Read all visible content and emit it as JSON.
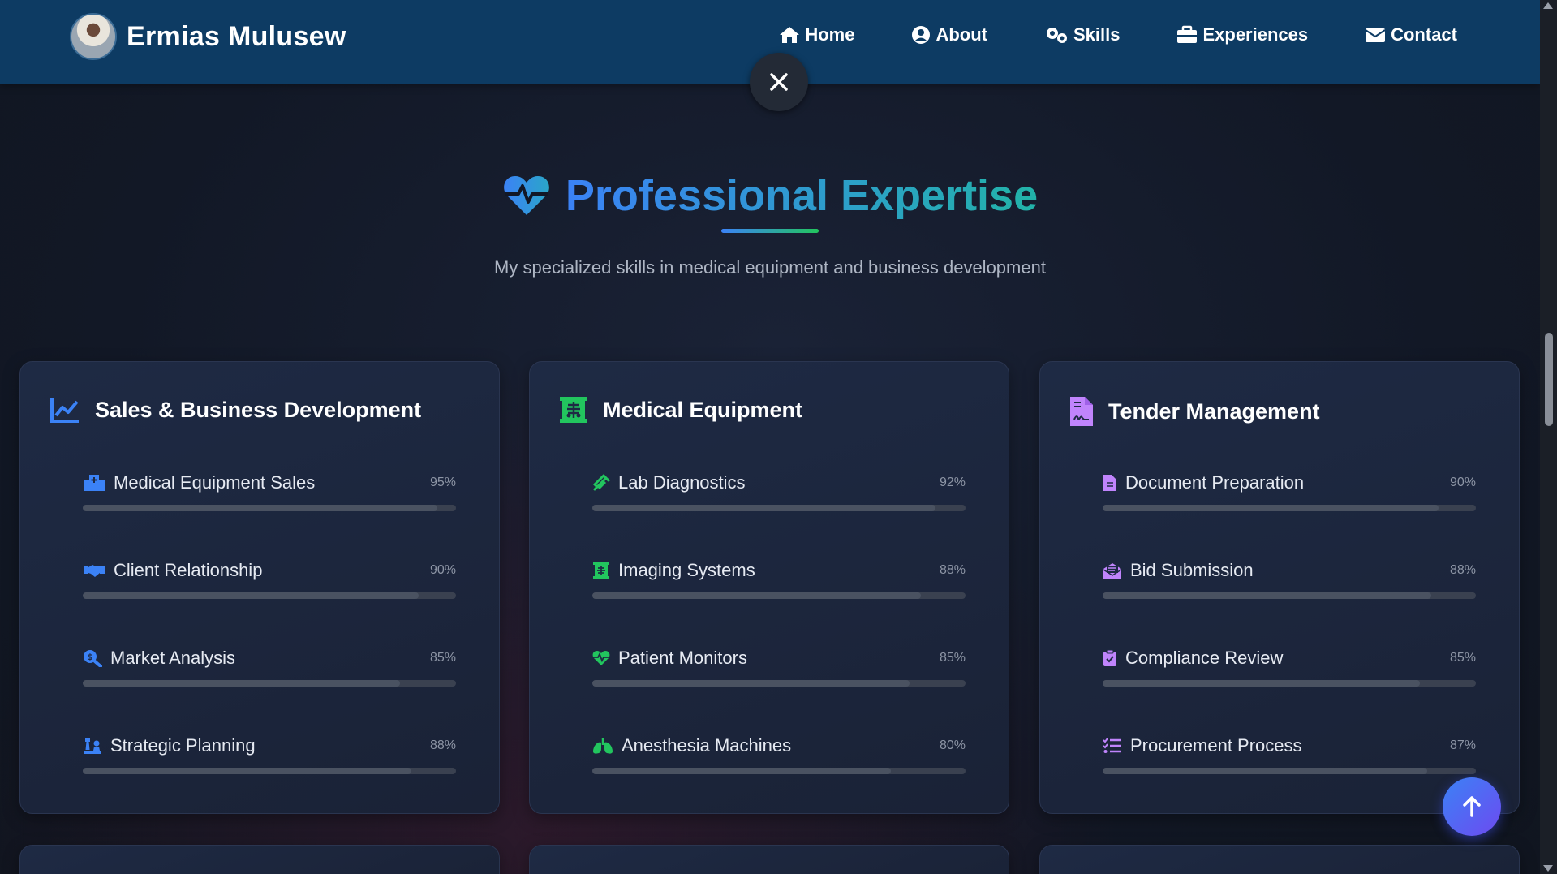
{
  "header": {
    "brand_name": "Ermias Mulusew",
    "nav": [
      {
        "label": "Home",
        "icon": "home-icon"
      },
      {
        "label": "About",
        "icon": "user-circle-icon"
      },
      {
        "label": "Skills",
        "icon": "gears-icon"
      },
      {
        "label": "Experiences",
        "icon": "briefcase-icon"
      },
      {
        "label": "Contact",
        "icon": "envelope-icon"
      }
    ]
  },
  "section": {
    "title": "Professional Expertise",
    "subtitle": "My specialized skills in medical equipment and business development"
  },
  "cards": [
    {
      "title": "Sales & Business Development",
      "icon": "chart-line-icon",
      "icon_color": "#3b82f6",
      "skills": [
        {
          "label": "Medical Equipment Sales",
          "pct_text": "95%",
          "level": 0.95,
          "icon": "hospital-icon"
        },
        {
          "label": "Client Relationship",
          "pct_text": "90%",
          "level": 0.9,
          "icon": "handshake-icon"
        },
        {
          "label": "Market Analysis",
          "pct_text": "85%",
          "level": 0.85,
          "icon": "search-dollar-icon"
        },
        {
          "label": "Strategic Planning",
          "pct_text": "88%",
          "level": 0.88,
          "icon": "chess-icon"
        }
      ]
    },
    {
      "title": "Medical Equipment",
      "icon": "x-ray-icon",
      "icon_color": "#22c55e",
      "skills": [
        {
          "label": "Lab Diagnostics",
          "pct_text": "92%",
          "level": 0.92,
          "icon": "syringe-icon"
        },
        {
          "label": "Imaging Systems",
          "pct_text": "88%",
          "level": 0.88,
          "icon": "x-ray-icon"
        },
        {
          "label": "Patient Monitors",
          "pct_text": "85%",
          "level": 0.85,
          "icon": "heartbeat-icon"
        },
        {
          "label": "Anesthesia Machines",
          "pct_text": "80%",
          "level": 0.8,
          "icon": "lungs-icon"
        }
      ]
    },
    {
      "title": "Tender Management",
      "icon": "file-contract-icon",
      "icon_color": "#c084fc",
      "skills": [
        {
          "label": "Document Preparation",
          "pct_text": "90%",
          "level": 0.9,
          "icon": "file-icon"
        },
        {
          "label": "Bid Submission",
          "pct_text": "88%",
          "level": 0.88,
          "icon": "envelope-open-icon"
        },
        {
          "label": "Compliance Review",
          "pct_text": "85%",
          "level": 0.85,
          "icon": "clipboard-check-icon"
        },
        {
          "label": "Procurement Process",
          "pct_text": "87%",
          "level": 0.87,
          "icon": "tasks-icon"
        }
      ]
    }
  ]
}
